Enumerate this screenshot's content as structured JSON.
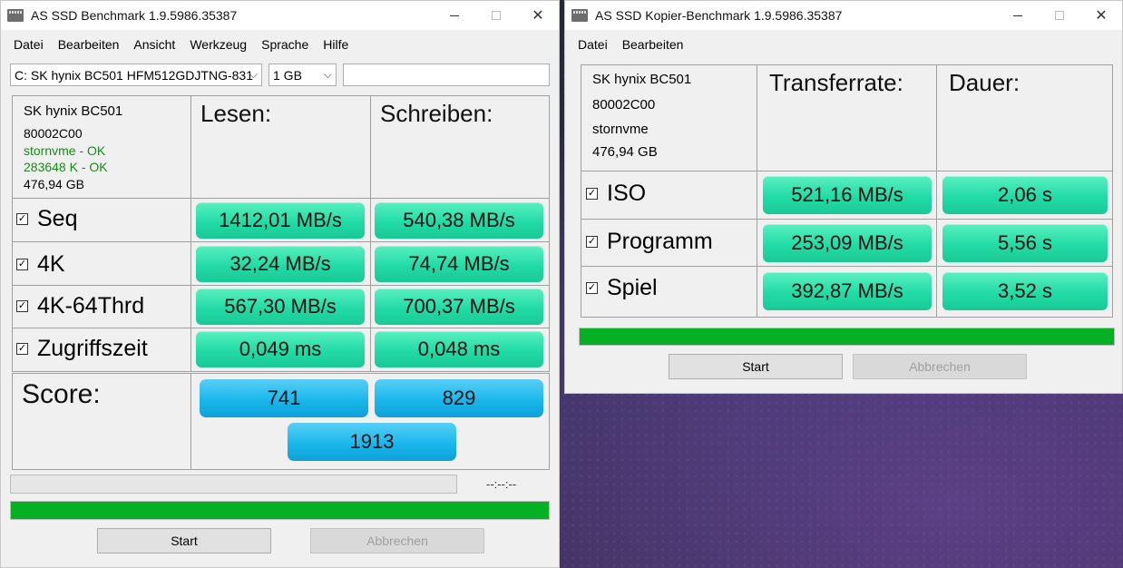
{
  "left_window": {
    "title": "AS SSD Benchmark 1.9.5986.35387",
    "menu": [
      "Datei",
      "Bearbeiten",
      "Ansicht",
      "Werkzeug",
      "Sprache",
      "Hilfe"
    ],
    "drive_select": "C: SK hynix BC501 HFM512GDJTNG-831",
    "size_select": "1 GB",
    "name_input": "",
    "drive_info": {
      "model": "SK hynix BC501",
      "firmware": "80002C00",
      "driver": "stornvme - OK",
      "alignment": "283648 K - OK",
      "capacity": "476,94 GB"
    },
    "col_read": "Lesen:",
    "col_write": "Schreiben:",
    "rows": [
      {
        "label": "Seq",
        "read": "1412,01 MB/s",
        "write": "540,38 MB/s",
        "checked": true
      },
      {
        "label": "4K",
        "read": "32,24 MB/s",
        "write": "74,74 MB/s",
        "checked": true
      },
      {
        "label": "4K-64Thrd",
        "read": "567,30 MB/s",
        "write": "700,37 MB/s",
        "checked": true
      },
      {
        "label": "Zugriffszeit",
        "read": "0,049 ms",
        "write": "0,048 ms",
        "checked": true
      }
    ],
    "score_label": "Score:",
    "score_read": "741",
    "score_write": "829",
    "score_total": "1913",
    "time_display": "--:--:--",
    "progress_small": 0,
    "progress_main": 1.0,
    "start_label": "Start",
    "cancel_label": "Abbrechen"
  },
  "right_window": {
    "title": "AS SSD Kopier-Benchmark 1.9.5986.35387",
    "menu": [
      "Datei",
      "Bearbeiten"
    ],
    "drive_info": {
      "model": "SK hynix BC501",
      "firmware": "80002C00",
      "driver": "stornvme",
      "capacity": "476,94 GB"
    },
    "col_rate": "Transferrate:",
    "col_duration": "Dauer:",
    "rows": [
      {
        "label": "ISO",
        "rate": "521,16 MB/s",
        "duration": "2,06 s",
        "checked": true
      },
      {
        "label": "Programm",
        "rate": "253,09 MB/s",
        "duration": "5,56 s",
        "checked": true
      },
      {
        "label": "Spiel",
        "rate": "392,87 MB/s",
        "duration": "3,52 s",
        "checked": true
      }
    ],
    "progress_main": 1.0,
    "start_label": "Start",
    "cancel_label": "Abbrechen"
  },
  "icons": {
    "app": "disk-drive-icon",
    "checkbox": "checkbox-checked-icon"
  },
  "colors": {
    "value_green": "#22dba6",
    "score_blue": "#1ab7ec",
    "progress_green": "#06b025"
  }
}
